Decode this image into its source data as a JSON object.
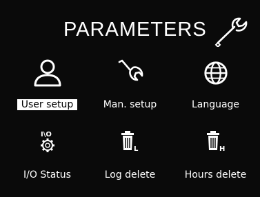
{
  "title": "PARAMETERS",
  "title_icon": "wrench-icon",
  "menu": {
    "items": [
      {
        "id": "user-setup",
        "label": "User setup",
        "icon": "user-icon",
        "selected": true
      },
      {
        "id": "man-setup",
        "label": "Man. setup",
        "icon": "wrench-icon",
        "selected": false
      },
      {
        "id": "language",
        "label": "Language",
        "icon": "globe-icon",
        "selected": false
      },
      {
        "id": "io-status",
        "label": "I/O Status",
        "icon": "io-gear-icon",
        "selected": false
      },
      {
        "id": "log-delete",
        "label": "Log delete",
        "icon": "trash-log-icon",
        "badge": "L",
        "selected": false
      },
      {
        "id": "hours-delete",
        "label": "Hours delete",
        "icon": "trash-hours-icon",
        "badge": "H",
        "selected": false
      }
    ]
  },
  "colors": {
    "background": "#0a0a0a",
    "foreground": "#ffffff",
    "selected_bg": "#ffffff",
    "selected_fg": "#000000"
  }
}
